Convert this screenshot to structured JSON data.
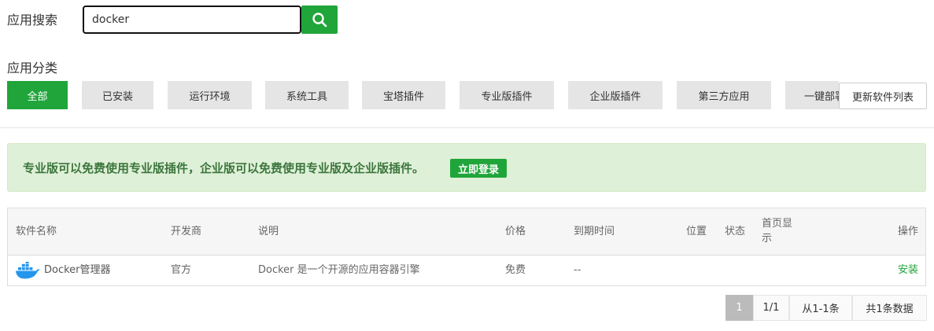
{
  "search": {
    "label": "应用搜索",
    "value": "docker"
  },
  "categories": {
    "label": "应用分类",
    "items": [
      "全部",
      "已安装",
      "运行环境",
      "系统工具",
      "宝塔插件",
      "专业版插件",
      "企业版插件",
      "第三方应用",
      "一键部署"
    ],
    "update_label": "更新软件列表"
  },
  "promo": {
    "text": "专业版可以免费使用专业版插件，企业版可以免费使用专业版及企业版插件。",
    "button": "立即登录"
  },
  "table": {
    "headers": [
      "软件名称",
      "开发商",
      "说明",
      "价格",
      "到期时间",
      "位置",
      "状态",
      "首页显示",
      "操作"
    ],
    "header_homepage_line1": "首页显",
    "header_homepage_line2": "示",
    "rows": [
      {
        "name": "Docker管理器",
        "developer": "官方",
        "description": "Docker 是一个开源的应用容器引擎",
        "price": "免费",
        "expiry": "--",
        "action": "安装",
        "icon": "docker-icon"
      }
    ]
  },
  "pagination": {
    "current": "1",
    "pages": "1/1",
    "range": "从1-1条",
    "total": "共1条数据"
  },
  "colors": {
    "primary": "#20a53a",
    "promo_bg": "#dff0d8",
    "promo_text": "#3c763d"
  }
}
